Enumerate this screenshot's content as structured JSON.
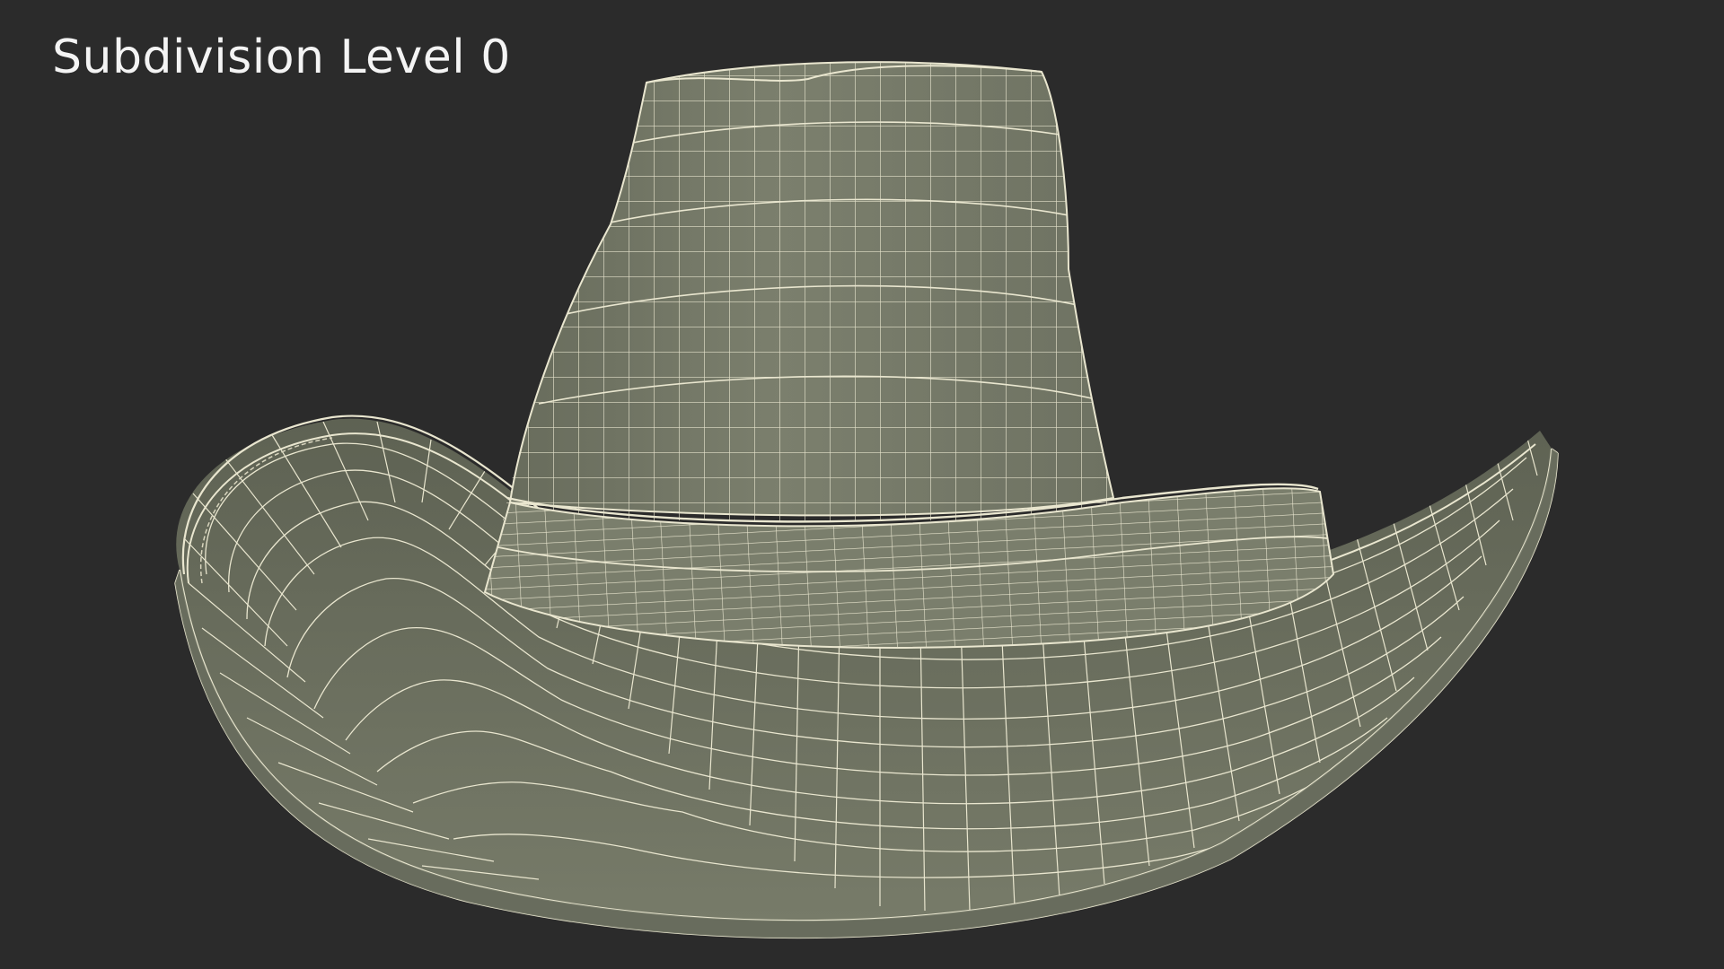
{
  "caption": "Subdivision Level 0",
  "colors": {
    "background": "#2b2b2b",
    "surface": "#767a69",
    "surface_shadow": "#5f6354",
    "wire": "#e9e6cf"
  },
  "model": {
    "subject": "hat-mesh",
    "wireframe": true
  }
}
